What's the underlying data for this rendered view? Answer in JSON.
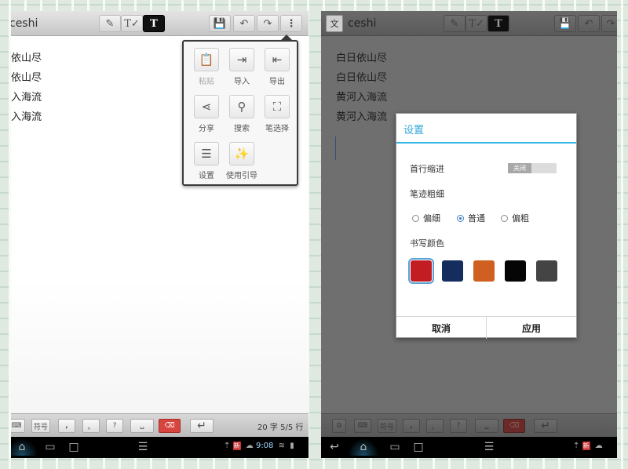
{
  "left": {
    "title": "ceshi",
    "toolbar": {
      "pen": "✎",
      "text_mode": "T✓",
      "text": "T",
      "save": "💾",
      "undo": "↶",
      "redo": "↷",
      "more": "⋮"
    },
    "lines": [
      "依山尽",
      "依山尽",
      "入海流",
      "入海流"
    ],
    "menu": [
      {
        "label": "粘贴",
        "icon": "📋"
      },
      {
        "label": "导入",
        "icon": "⇥"
      },
      {
        "label": "导出",
        "icon": "⇤"
      },
      {
        "label": "分享",
        "icon": "⋖"
      },
      {
        "label": "搜索",
        "icon": "⚲"
      },
      {
        "label": "笔选择",
        "icon": "⛶"
      },
      {
        "label": "设置",
        "icon": "☰"
      },
      {
        "label": "使用引导",
        "icon": "✨"
      }
    ],
    "keys": {
      "keyboard": "⌨",
      "symbols": "符号",
      "comma": ",",
      "period": "。",
      "question": "?",
      "space": "␣",
      "delete": "⌫",
      "enter": "↵"
    },
    "status": "20 字  5/5 行",
    "sys": {
      "time": "9:08",
      "badge": "新"
    }
  },
  "right": {
    "title": "ceshi",
    "app_icon": "文",
    "toolbar": {
      "pen": "✎",
      "text_mode": "T✓",
      "text": "T",
      "save": "💾",
      "undo": "↶"
    },
    "lines": [
      "白日依山尽",
      "白日依山尽",
      "黄河入海流",
      "黄河入海流"
    ],
    "keys": {
      "copy": "⧉",
      "keyboard": "⌨",
      "symbols": "符号",
      "comma": ",",
      "period": "。",
      "question": "?",
      "space": "␣",
      "delete": "⌫",
      "enter": "↵"
    },
    "sys": {
      "badge": "新"
    }
  },
  "dialog": {
    "title": "设置",
    "indent_label": "首行缩进",
    "indent_toggle": "关闭",
    "stroke_label": "笔迹粗细",
    "stroke_options": [
      {
        "label": "偏细",
        "checked": false
      },
      {
        "label": "普通",
        "checked": true
      },
      {
        "label": "偏粗",
        "checked": false
      }
    ],
    "color_label": "书写颜色",
    "colors": [
      "#c21d23",
      "#142c5e",
      "#d06020",
      "#050505",
      "#444444"
    ],
    "selected_color": 0,
    "cancel": "取消",
    "apply": "应用"
  }
}
